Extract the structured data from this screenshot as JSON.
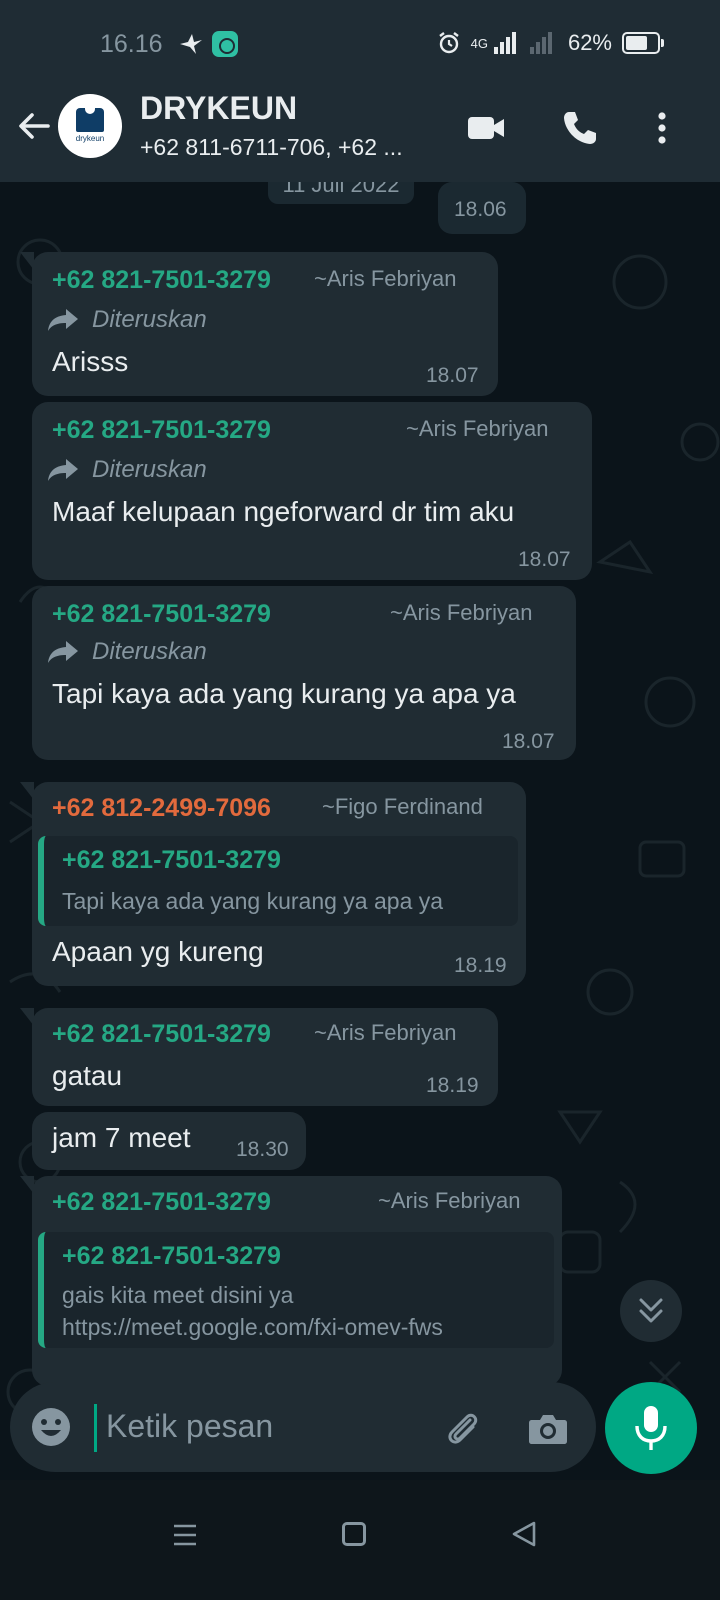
{
  "status_bar": {
    "time": "16.16",
    "network": "4G",
    "battery": "62%",
    "battery_level": 0.62
  },
  "header": {
    "title": "DRYKEUN",
    "subtitle": "+62 811-6711-706, +62 ...",
    "avatar_brand": "drykeun",
    "icons": [
      "back-arrow-icon",
      "video-call-icon",
      "phone-icon",
      "more-vert-icon"
    ]
  },
  "chat": {
    "date_chip": "11 Juli 2022",
    "top_time": "18.06",
    "messages": [
      {
        "sender": "+62 821-7501-3279",
        "alias": "~Aris Febriyan",
        "forwarded": "Diteruskan",
        "text": "Arisss",
        "time": "18.07"
      },
      {
        "sender": "+62 821-7501-3279",
        "alias": "~Aris Febriyan",
        "forwarded": "Diteruskan",
        "text": "Maaf kelupaan ngeforward dr tim aku",
        "time": "18.07"
      },
      {
        "sender": "+62 821-7501-3279",
        "alias": "~Aris Febriyan",
        "forwarded": "Diteruskan",
        "text": "Tapi kaya ada yang kurang ya apa ya",
        "time": "18.07"
      },
      {
        "sender": "+62 812-2499-7096",
        "alias": "~Figo Ferdinand",
        "quote_name": "+62 821-7501-3279",
        "quote_text": "Tapi kaya ada yang kurang ya apa ya",
        "text": "Apaan yg kureng",
        "time": "18.19"
      },
      {
        "sender": "+62 821-7501-3279",
        "alias": "~Aris Febriyan",
        "text": "gatau",
        "time": "18.19"
      },
      {
        "text": "jam 7 meet",
        "time": "18.30"
      },
      {
        "sender": "+62 821-7501-3279",
        "alias": "~Aris Febriyan",
        "quote_name": "+62 821-7501-3279",
        "quote_line1": "gais kita meet disini ya",
        "quote_line2": "https://meet.google.com/fxi-omev-fws"
      }
    ]
  },
  "input": {
    "placeholder": "Ketik pesan"
  },
  "colors": {
    "header_bg": "#1f2c34",
    "chat_bg": "#0b141a",
    "bubble_bg": "#202c33",
    "accent_green": "#00a884",
    "sender_green": "#25a884",
    "sender_orange": "#e26a3d"
  }
}
